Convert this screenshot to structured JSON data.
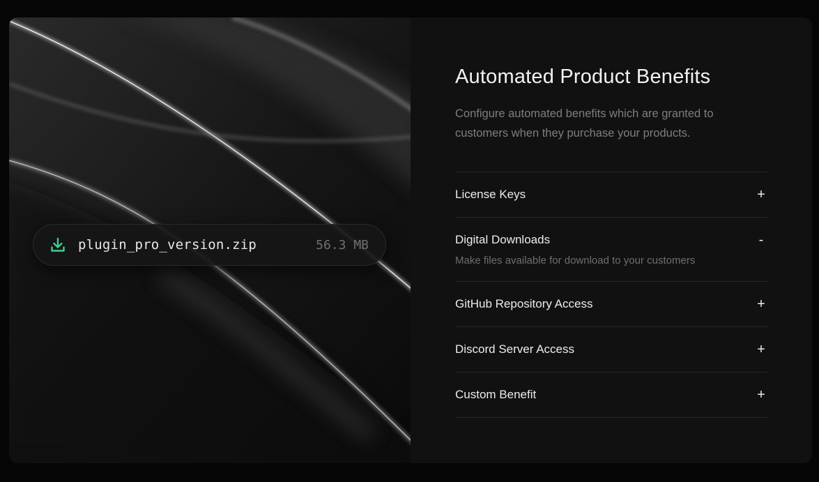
{
  "file": {
    "icon": "download-icon",
    "name": "plugin_pro_version.zip",
    "size": "56.3 MB",
    "accent": "#3ecf8e"
  },
  "benefits": {
    "title": "Automated Product Benefits",
    "subtitle": "Configure automated benefits which are granted to customers when they purchase your products.",
    "items": [
      {
        "label": "License Keys",
        "toggle": "+",
        "expanded": false
      },
      {
        "label": "Digital Downloads",
        "toggle": "-",
        "expanded": true,
        "description": "Make files available for download to your customers"
      },
      {
        "label": "GitHub Repository Access",
        "toggle": "+",
        "expanded": false
      },
      {
        "label": "Discord Server Access",
        "toggle": "+",
        "expanded": false
      },
      {
        "label": "Custom Benefit",
        "toggle": "+",
        "expanded": false
      }
    ]
  },
  "colors": {
    "background": "#050505",
    "card": "#111111",
    "text": "#ececec",
    "muted": "#7e7e7e",
    "divider": "#262626"
  }
}
